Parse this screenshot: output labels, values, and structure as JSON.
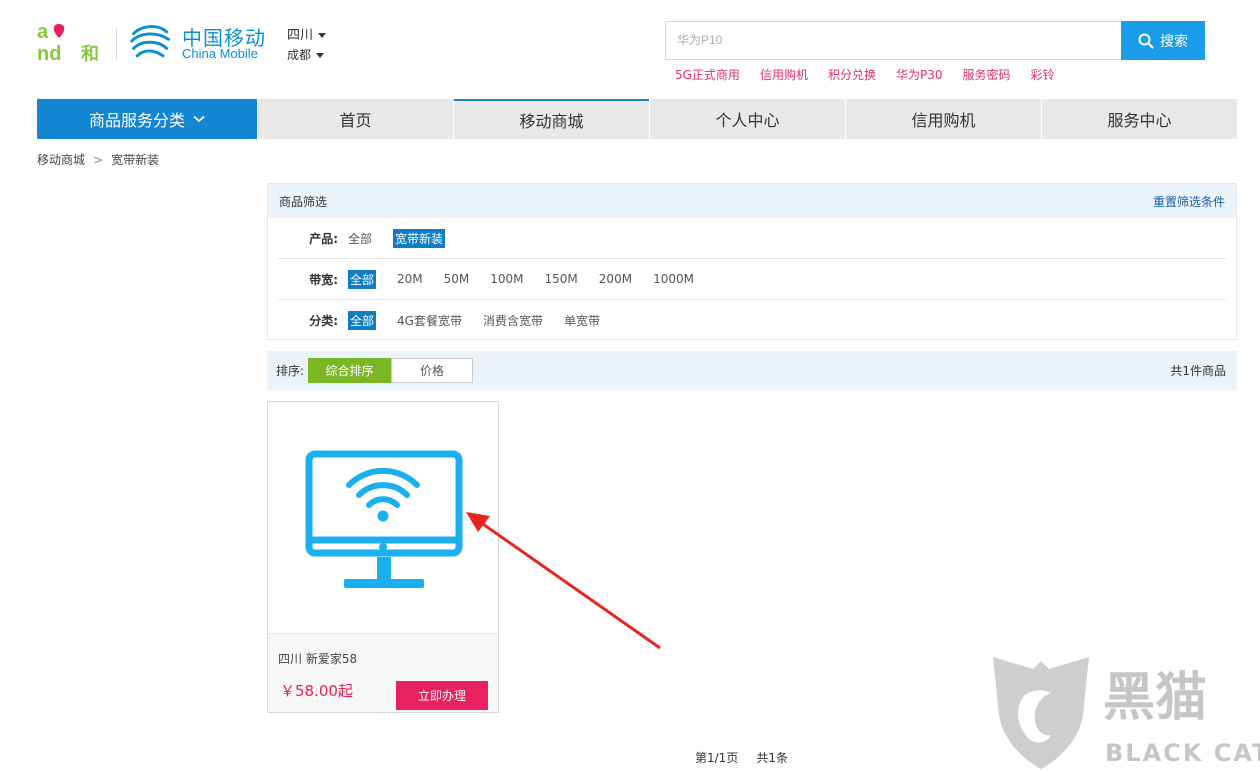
{
  "header": {
    "brand_logo_text": "and和",
    "cm_name_cn": "中国移动",
    "cm_name_en": "China Mobile",
    "province": "四川",
    "city": "成都",
    "search_placeholder": "华为P10",
    "search_button": "搜索",
    "hot_words": [
      "5G正式商用",
      "信用购机",
      "积分兑换",
      "华为P30",
      "服务密码",
      "彩铃"
    ]
  },
  "nav": {
    "category_label": "商品服务分类",
    "items": [
      "首页",
      "移动商城",
      "个人中心",
      "信用购机",
      "服务中心"
    ],
    "active_item": "移动商城"
  },
  "breadcrumb": [
    "移动商城",
    "宽带新装"
  ],
  "filter": {
    "title": "商品筛选",
    "reset_label": "重置筛选条件",
    "rows": [
      {
        "label": "产品:",
        "options": [
          "全部",
          "宽带新装"
        ],
        "selected": "宽带新装"
      },
      {
        "label": "带宽:",
        "options": [
          "全部",
          "20M",
          "50M",
          "100M",
          "150M",
          "200M",
          "1000M"
        ],
        "selected": "全部"
      },
      {
        "label": "分类:",
        "options": [
          "全部",
          "4G套餐宽带",
          "消费含宽带",
          "单宽带"
        ],
        "selected": "全部"
      }
    ]
  },
  "sort": {
    "label": "排序:",
    "options": [
      "综合排序",
      "价格"
    ],
    "active": "综合排序",
    "count_text": "共1件商品"
  },
  "product": {
    "name": "四川 新爱家58",
    "price": "￥58.00起",
    "button": "立即办理",
    "image_icon": "monitor-wifi-icon"
  },
  "pager": {
    "page_text": "第1/1页",
    "total_text": "共1条"
  },
  "watermark": {
    "cn": "黑猫",
    "en": "BLACK CAT"
  },
  "colors": {
    "brand_blue": "#1487d4",
    "search_blue": "#1b9ce8",
    "hot_pink": "#e0306a",
    "sort_green": "#7bb625",
    "price_red": "#e8214f",
    "icon_cyan": "#1ab0f0",
    "annotation_red": "#e8241f"
  }
}
